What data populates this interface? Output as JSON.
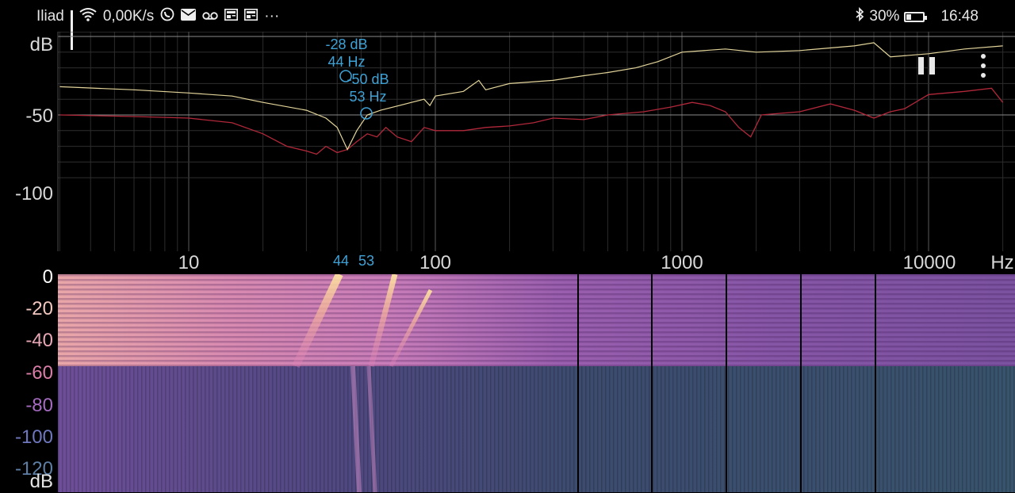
{
  "status_bar": {
    "carrier": "Iliad",
    "speed": "0,00K/s",
    "battery": "30%",
    "battery_level": 0.3,
    "time": "16:48",
    "more": "···",
    "icons": [
      "signal-icon",
      "wifi-icon",
      "whatsapp-icon",
      "mail-icon",
      "voicemail-icon",
      "news-icon",
      "news-icon",
      "bluetooth-icon",
      "battery-icon"
    ]
  },
  "spectrum": {
    "y_unit": "dB",
    "y_ticks": [
      "-50",
      "-100"
    ],
    "x_ticks": [
      "10",
      "100",
      "1000",
      "10000"
    ],
    "x_unit": "Hz",
    "peaks": [
      {
        "db": "-28 dB",
        "hz": "44 Hz"
      },
      {
        "db": "-50 dB",
        "hz": "53 Hz"
      }
    ],
    "peak_axis_marks": [
      "44",
      "53"
    ],
    "colors": {
      "red_trace": "#b0283a",
      "yellow_trace": "#e3d59a",
      "marker": "#3fa2d6",
      "grid": "#3a3a3a"
    }
  },
  "spectrogram": {
    "y_ticks": [
      "0",
      "-20",
      "-40",
      "-60",
      "-80",
      "-100",
      "-120"
    ],
    "y_unit": "dB",
    "tick_colors": [
      "#ffffff",
      "#f1c7c0",
      "#e8a7b5",
      "#d97da8",
      "#a46bc0",
      "#6f78bf",
      "#5e7fa5"
    ]
  },
  "controls": {
    "pause": "pause-icon",
    "menu": "more-vert-icon"
  }
}
